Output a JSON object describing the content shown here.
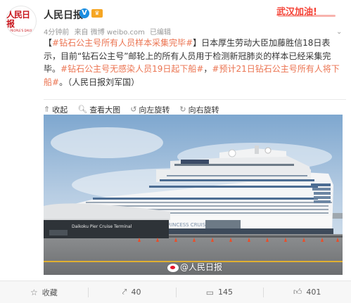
{
  "account": {
    "name": "人民日报",
    "verified_mark": "V",
    "avatar_logo_text": "人民日报",
    "avatar_logo_sub": "PEOPLE'S DAILY"
  },
  "meta": {
    "time": "4分钟前",
    "source": "来自 微博 weibo.com",
    "edited": "已编辑"
  },
  "banner": {
    "text": "武汉加油!",
    "color": "#f54337"
  },
  "post": {
    "open_bracket": "【",
    "title_tag": "#钻石公主号所有人员样本采集完毕#",
    "text_1": "】日本厚生劳动大臣加藤胜信18日表示，目前“钻石公主号”邮轮上的所有人员用于检测新冠肺炎的样本已经采集完毕。",
    "tag_2": "#钻石公主号无感染人员19日起下船#",
    "sep": "，",
    "tag_3": "#预计21日钻石公主号所有人将下船#",
    "text_2": "。（人民日报刘军国）",
    "tag_color": "#eb7350"
  },
  "image_actions": {
    "collapse": "收起",
    "view_large": "查看大图",
    "rotate_left": "向左旋转",
    "rotate_right": "向右旋转"
  },
  "photo": {
    "terminal_sign": "Daikoku  Pier  Cruise  Terminal",
    "ship_name": "PRINCESS CRUISES",
    "watermark": "@人民日报"
  },
  "footer": {
    "favorite": "收藏",
    "repost_count": "40",
    "comment_count": "145",
    "like_count": "401"
  }
}
